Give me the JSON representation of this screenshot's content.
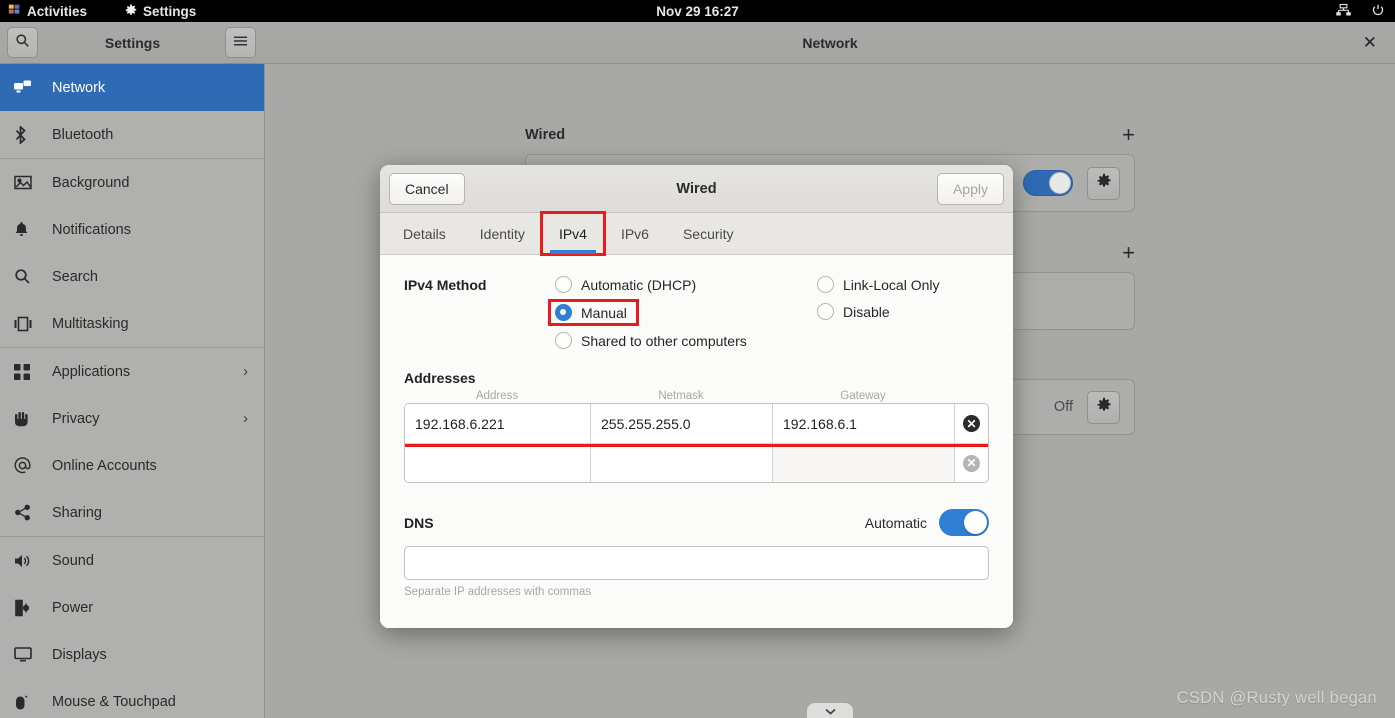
{
  "topbar": {
    "activities": "Activities",
    "app_name": "Settings",
    "clock": "Nov 29  16:27",
    "icons": [
      "network-wired-icon",
      "power-icon"
    ]
  },
  "headerbar": {
    "search_icon": "search-icon",
    "menu_icon": "hamburger-menu-icon",
    "sidebar_title": "Settings",
    "window_title": "Network",
    "close_label": "✕"
  },
  "sidebar": {
    "items": [
      {
        "label": "Network",
        "icon": "network-wired-icon",
        "active": true,
        "chevron": false
      },
      {
        "label": "Bluetooth",
        "icon": "bluetooth-icon",
        "active": false,
        "chevron": false
      },
      {
        "label": "Background",
        "icon": "image-icon",
        "active": false,
        "chevron": false,
        "separator_before": true
      },
      {
        "label": "Notifications",
        "icon": "bell-icon",
        "active": false,
        "chevron": false
      },
      {
        "label": "Search",
        "icon": "search-icon",
        "active": false,
        "chevron": false
      },
      {
        "label": "Multitasking",
        "icon": "multitasking-icon",
        "active": false,
        "chevron": false
      },
      {
        "label": "Applications",
        "icon": "grid-apps-icon",
        "active": false,
        "chevron": true,
        "separator_before": true
      },
      {
        "label": "Privacy",
        "icon": "hand-icon",
        "active": false,
        "chevron": true
      },
      {
        "label": "Online Accounts",
        "icon": "at-sign-icon",
        "active": false,
        "chevron": false
      },
      {
        "label": "Sharing",
        "icon": "share-nodes-icon",
        "active": false,
        "chevron": false
      },
      {
        "label": "Sound",
        "icon": "speaker-icon",
        "active": false,
        "chevron": false,
        "separator_before": true
      },
      {
        "label": "Power",
        "icon": "battery-icon",
        "active": false,
        "chevron": false
      },
      {
        "label": "Displays",
        "icon": "monitor-icon",
        "active": false,
        "chevron": false
      },
      {
        "label": "Mouse & Touchpad",
        "icon": "mouse-icon",
        "active": false,
        "chevron": false
      }
    ]
  },
  "network_panel": {
    "wired_section_title": "Wired",
    "wired_add_label": "+",
    "second_add_label": "+",
    "off_label": "Off",
    "gear_icon": "gear-icon"
  },
  "dialog": {
    "cancel_label": "Cancel",
    "title": "Wired",
    "apply_label": "Apply",
    "apply_enabled": false,
    "tabs": [
      {
        "label": "Details",
        "active": false,
        "highlighted": false
      },
      {
        "label": "Identity",
        "active": false,
        "highlighted": false
      },
      {
        "label": "IPv4",
        "active": true,
        "highlighted": true
      },
      {
        "label": "IPv6",
        "active": false,
        "highlighted": false
      },
      {
        "label": "Security",
        "active": false,
        "highlighted": false
      }
    ],
    "ipv4": {
      "method_label": "IPv4 Method",
      "options_col1": [
        {
          "label": "Automatic (DHCP)",
          "selected": false,
          "highlighted": false
        },
        {
          "label": "Manual",
          "selected": true,
          "highlighted": true
        },
        {
          "label": "Shared to other computers",
          "selected": false,
          "highlighted": false
        }
      ],
      "options_col2": [
        {
          "label": "Link-Local Only",
          "selected": false,
          "highlighted": false
        },
        {
          "label": "Disable",
          "selected": false,
          "highlighted": false
        }
      ],
      "addresses_title": "Addresses",
      "column_headers": [
        "Address",
        "Netmask",
        "Gateway"
      ],
      "rows": [
        {
          "address": "192.168.6.221",
          "netmask": "255.255.255.0",
          "gateway": "192.168.6.1",
          "highlighted": true,
          "delete_active": true
        },
        {
          "address": "",
          "netmask": "",
          "gateway": "",
          "highlighted": false,
          "delete_active": false
        }
      ],
      "dns_title": "DNS",
      "dns_auto_label": "Automatic",
      "dns_auto_on": true,
      "dns_value": "",
      "dns_hint": "Separate IP addresses with commas"
    }
  },
  "watermark": "CSDN @Rusty well began"
}
